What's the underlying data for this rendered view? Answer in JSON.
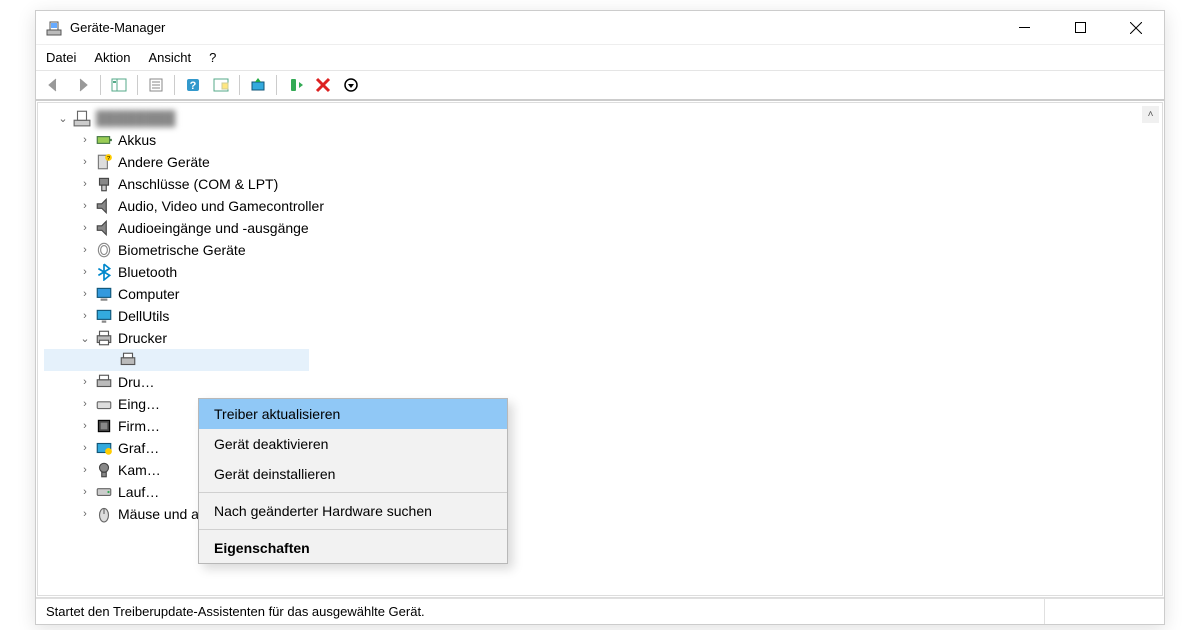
{
  "window": {
    "title": "Geräte-Manager"
  },
  "menu": {
    "items": [
      "Datei",
      "Aktion",
      "Ansicht",
      "?"
    ]
  },
  "tree": {
    "root": {
      "label": "████████"
    },
    "nodes": [
      {
        "label": "Akkus",
        "icon": "battery"
      },
      {
        "label": "Andere Geräte",
        "icon": "unknown"
      },
      {
        "label": "Anschlüsse (COM & LPT)",
        "icon": "port"
      },
      {
        "label": "Audio, Video und Gamecontroller",
        "icon": "audio"
      },
      {
        "label": "Audioeingänge und -ausgänge",
        "icon": "audio"
      },
      {
        "label": "Biometrische Geräte",
        "icon": "biometric"
      },
      {
        "label": "Bluetooth",
        "icon": "bluetooth"
      },
      {
        "label": "Computer",
        "icon": "computer"
      },
      {
        "label": "DellUtils",
        "icon": "monitor"
      },
      {
        "label": "Drucker",
        "icon": "printer",
        "expanded": true
      },
      {
        "label": "Dru…",
        "icon": "printer"
      },
      {
        "label": "Eing…",
        "icon": "hid"
      },
      {
        "label": "Firm…",
        "icon": "firmware"
      },
      {
        "label": "Graf…",
        "icon": "display"
      },
      {
        "label": "Kam…",
        "icon": "camera"
      },
      {
        "label": "Lauf…",
        "icon": "drive"
      },
      {
        "label": "Mäuse und andere Zeigegeräte",
        "icon": "mouse"
      }
    ]
  },
  "context_menu": {
    "items": [
      {
        "label": "Treiber aktualisieren",
        "highlight": true
      },
      {
        "label": "Gerät deaktivieren"
      },
      {
        "label": "Gerät deinstallieren"
      },
      {
        "sep": true
      },
      {
        "label": "Nach geänderter Hardware suchen"
      },
      {
        "sep": true
      },
      {
        "label": "Eigenschaften",
        "bold": true
      }
    ]
  },
  "statusbar": {
    "text": "Startet den Treiberupdate-Assistenten für das ausgewählte Gerät."
  }
}
